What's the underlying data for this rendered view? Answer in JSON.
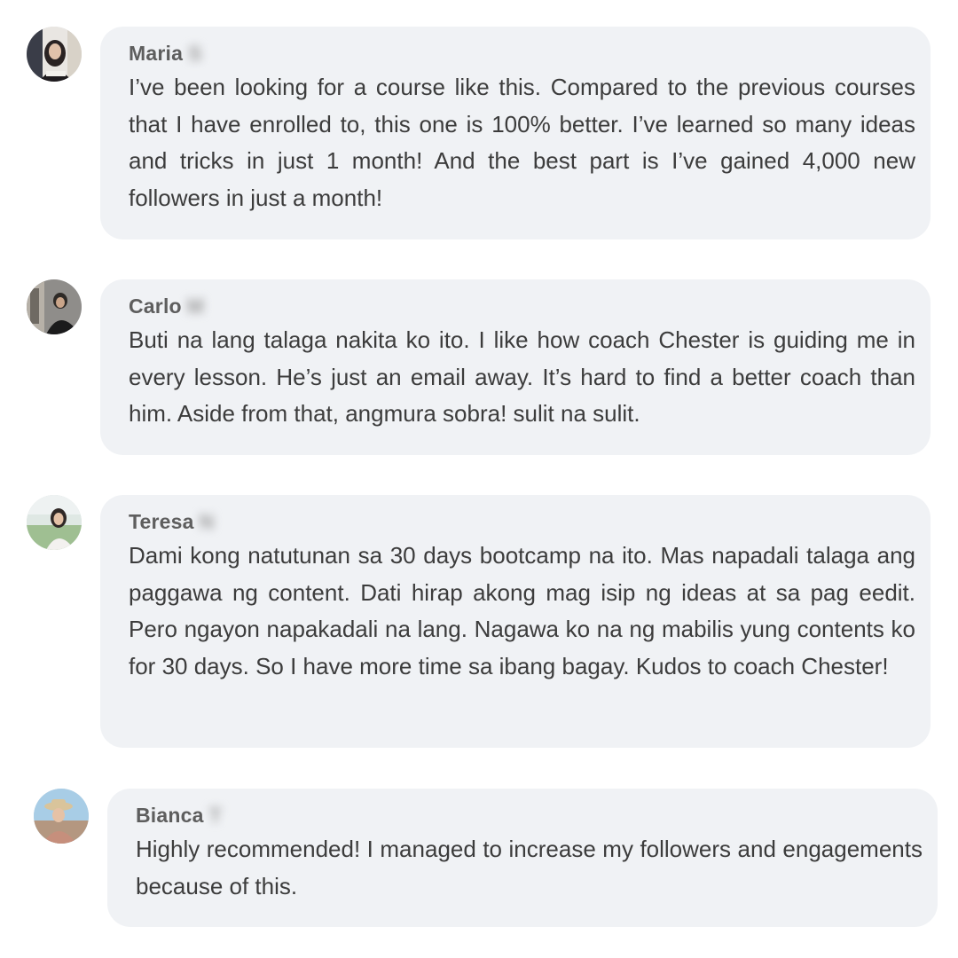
{
  "comments": [
    {
      "first_name": "Maria",
      "surname_blurred": "S",
      "text": "I’ve been looking for a course like this. Compared to the previous courses that I have enrolled to, this one is 100% better. I’ve learned so many ideas and tricks in just 1 month! And the best part is I’ve gained 4,000 new followers in just a month!"
    },
    {
      "first_name": "Carlo",
      "surname_blurred": "M",
      "text": "Buti na lang talaga nakita ko ito. I like how coach Chester is guiding me in every lesson. He’s just an email away. It’s hard to find a better coach than him. Aside from that, angmura sobra! sulit na sulit."
    },
    {
      "first_name": "Teresa",
      "surname_blurred": "N",
      "text": "Dami kong natutunan sa 30 days bootcamp na ito. Mas napadali talaga ang paggawa ng content. Dati hirap akong mag isip ng ideas at sa pag eedit. Pero ngayon napakadali na lang. Nagawa ko na ng mabilis yung contents ko for 30 days. So I have more time sa ibang bagay. Kudos to coach Chester!"
    },
    {
      "first_name": "Bianca",
      "surname_blurred": "T",
      "text": "Highly recommended! I managed to increase my followers and engagements because of this."
    }
  ],
  "colors": {
    "bubble_background": "#f0f2f5",
    "name_text": "#5e5e5e",
    "body_text": "#3c3c3c"
  }
}
